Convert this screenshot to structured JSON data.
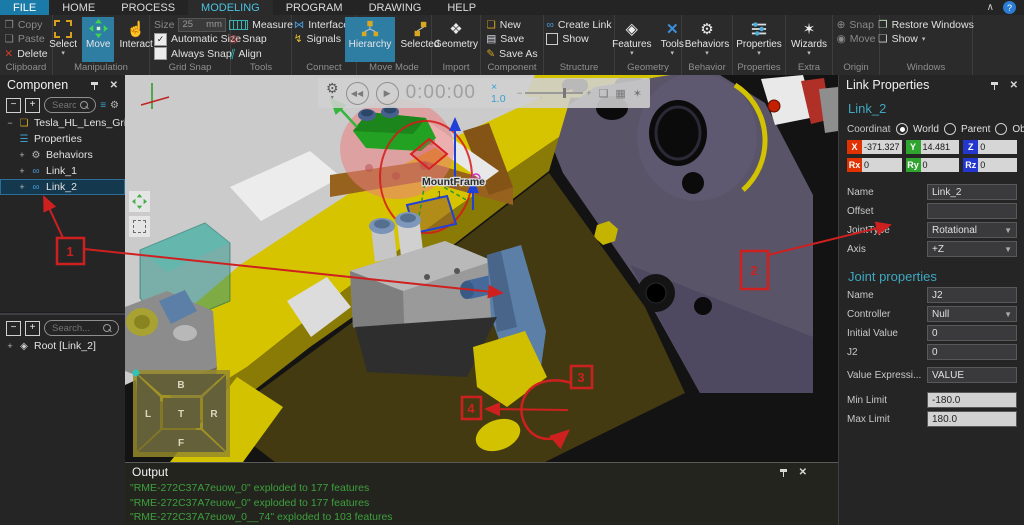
{
  "tabs": {
    "file": "FILE",
    "home": "HOME",
    "process": "PROCESS",
    "modeling": "MODELING",
    "program": "PROGRAM",
    "drawing": "DRAWING",
    "help": "HELP"
  },
  "ribbon": {
    "clipboard": {
      "group": "Clipboard",
      "copy": "Copy",
      "paste": "Paste",
      "del": "Delete"
    },
    "manipulation": {
      "group": "Manipulation",
      "select": "Select",
      "move": "Move",
      "interact": "Interact"
    },
    "grid_snap": {
      "group": "Grid Snap",
      "size_label": "Size",
      "size_value": "25",
      "unit": "mm",
      "automatic": "Automatic Size",
      "always": "Always Snap",
      "check": "✓"
    },
    "tools": {
      "group": "Tools",
      "measure": "Measure",
      "snap": "Snap",
      "align": "Align"
    },
    "connect": {
      "group": "Connect",
      "interfaces": "Interfaces",
      "signals": "Signals"
    },
    "move_mode": {
      "group": "Move Mode",
      "hierarchy": "Hierarchy",
      "selected": "Selected"
    },
    "import": {
      "group": "Import",
      "geometry": "Geometry"
    },
    "component": {
      "group": "Component",
      "new_item": "New",
      "save": "Save",
      "save_as": "Save As"
    },
    "structure": {
      "group": "Structure",
      "create_link": "Create Link",
      "show": "Show"
    },
    "geometry": {
      "group": "Geometry",
      "features": "Features",
      "tools": "Tools"
    },
    "behavior": {
      "group": "Behavior",
      "behaviors": "Behaviors"
    },
    "properties": {
      "group": "Properties",
      "properties": "Properties"
    },
    "extra": {
      "group": "Extra",
      "wizards": "Wizards"
    },
    "origin": {
      "group": "Origin",
      "snap": "Snap",
      "move": "Move"
    },
    "windows": {
      "group": "Windows",
      "restore": "Restore Windows",
      "show": "Show"
    }
  },
  "component_panel": {
    "title": "Componen",
    "search_placeholder": "Searc...",
    "tree": {
      "root": "Tesla_HL_Lens_Gripper_...",
      "properties": "Properties",
      "behaviors": "Behaviors",
      "link1": "Link_1",
      "link2": "Link_2"
    }
  },
  "root_panel": {
    "search_placeholder": "Search...",
    "item": "Root [Link_2]"
  },
  "viewport": {
    "time": "0:00:00",
    "speed": "× 1.0",
    "mount_frame": "MountFrame",
    "mount_frame_sub": "1",
    "cube": {
      "b": "B",
      "l": "L",
      "t": "T",
      "r": "R",
      "f": "F"
    },
    "ann": {
      "n1": "1",
      "n2": "2",
      "n3": "3",
      "n4": "4"
    }
  },
  "link_properties": {
    "title": "Link Properties",
    "header": "Link_2",
    "coordinates": "Coordinates",
    "world": "World",
    "parent": "Parent",
    "object": "Object",
    "x_tag": "X",
    "y_tag": "Y",
    "z_tag": "Z",
    "rx_tag": "Rx",
    "ry_tag": "Ry",
    "rz_tag": "Rz",
    "x": "-371.327",
    "y": "14.481",
    "z": "0",
    "rx": "0",
    "ry": "0",
    "rz": "0",
    "name_label": "Name",
    "name": "Link_2",
    "offset_label": "Offset",
    "offset": "",
    "joint_type_label": "JointType",
    "joint_type": "Rotational",
    "axis_label": "Axis",
    "axis": "+Z",
    "joint_heading": "Joint properties",
    "jname_label": "Name",
    "jname": "J2",
    "controller_label": "Controller",
    "controller": "Null",
    "initial_label": "Initial Value",
    "initial": "0",
    "j2_label": "J2",
    "j2": "0",
    "expr_label": "Value Expressi...",
    "expr": "VALUE",
    "min_label": "Min Limit",
    "min": "-180.0",
    "max_label": "Max Limit",
    "max": "180.0"
  },
  "output": {
    "title": "Output",
    "lines": [
      "\"RME-272C37A7euow_0\" exploded to 177 features",
      "\"RME-272C37A7euow_0\" exploded to 177 features",
      "\"RME-272C37A7euow_0__74\" exploded to 103 features"
    ]
  }
}
